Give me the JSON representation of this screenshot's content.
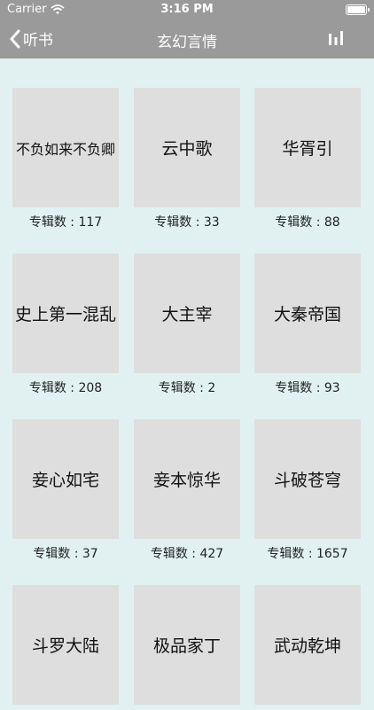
{
  "status_bar": {
    "carrier": "Carrier",
    "time": "3:16 PM"
  },
  "nav": {
    "back_label": "听书",
    "title": "玄幻言情"
  },
  "colors": {
    "nav_bg": "#9a9a9a",
    "page_bg": "#e1f1f1",
    "cover_bg": "#dedede"
  },
  "icons": {
    "back": "chevron-left-icon",
    "right": "bar-chart-icon",
    "wifi": "wifi-icon",
    "battery": "battery-icon"
  },
  "albums": [
    {
      "title": "不负如来不负卿",
      "count": "专辑数 : 117"
    },
    {
      "title": "云中歌",
      "count": "专辑数 : 33"
    },
    {
      "title": "华胥引",
      "count": "专辑数 : 88"
    },
    {
      "title": "史上第一混乱",
      "count": "专辑数 : 208"
    },
    {
      "title": "大主宰",
      "count": "专辑数 : 2"
    },
    {
      "title": "大秦帝国",
      "count": "专辑数 : 93"
    },
    {
      "title": "妾心如宅",
      "count": "专辑数 : 37"
    },
    {
      "title": "妾本惊华",
      "count": "专辑数 : 427"
    },
    {
      "title": "斗破苍穹",
      "count": "专辑数 : 1657"
    },
    {
      "title": "斗罗大陆",
      "count": ""
    },
    {
      "title": "极品家丁",
      "count": ""
    },
    {
      "title": "武动乾坤",
      "count": ""
    }
  ]
}
